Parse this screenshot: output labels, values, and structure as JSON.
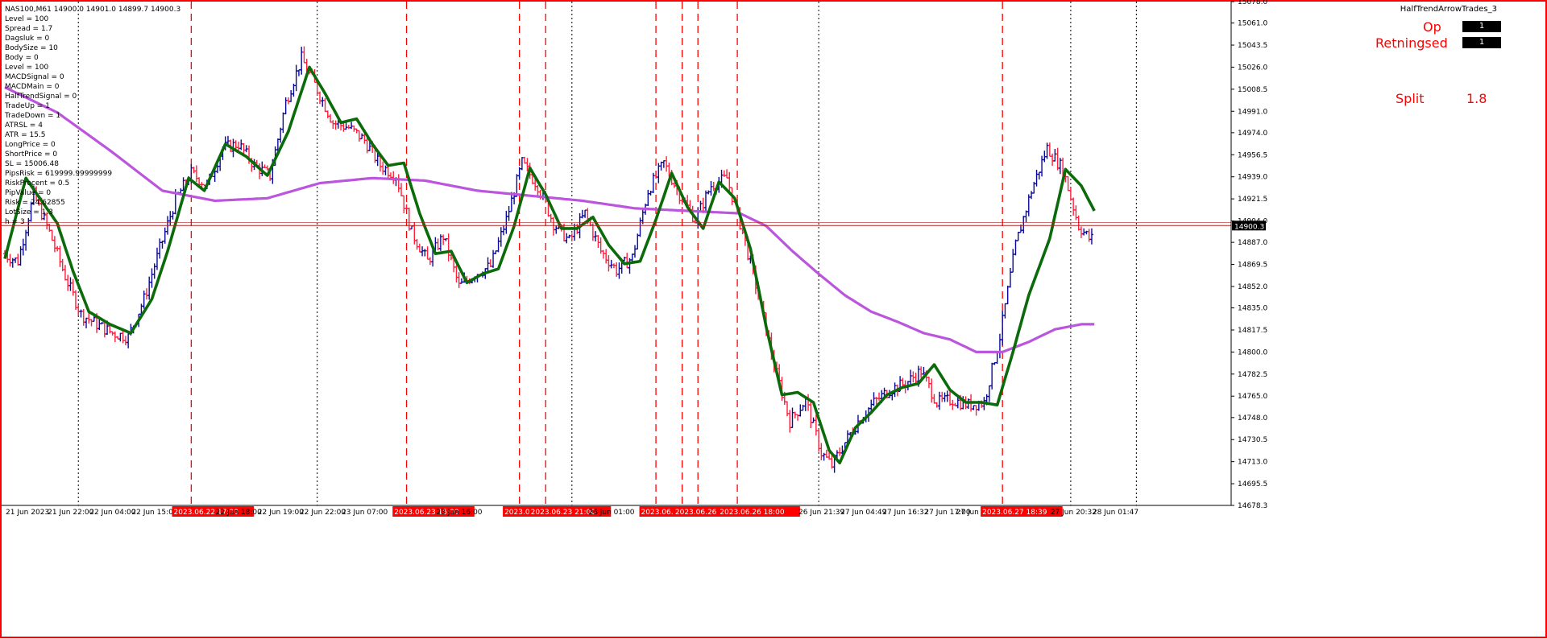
{
  "header": {
    "symbol_line": "NAS100,M61  14900.0 14901.0 14899.7 14900.3",
    "indicator_name": "HalfTrendArrowTrades_3",
    "info_lines": [
      "Level = 100",
      "Spread = 1.7",
      "Dagsluk = 0",
      "BodySize = 10",
      "Body = 0",
      "Level = 100",
      "MACDSignal = 0",
      "MACDMain = 0",
      "HalfTrendSignal = 0",
      "TradeUp = 1",
      "TradeDown = 1",
      "ATRSL = 4",
      "ATR = 15.5",
      "LongPrice = 0",
      "ShortPrice = 0",
      "SL = 15006.48",
      "PipsRisk = 619999.99999999",
      "RiskProcent = 0.5",
      "PipValue = 0",
      "Risk = 24.62855",
      "LotSize = 1.3",
      "h = 3"
    ]
  },
  "panel": {
    "op_label": "Op",
    "op_value": "1",
    "ret_label": "Retningsed",
    "ret_value": "1",
    "split_label": "Split",
    "split_value": "1.8"
  },
  "colors": {
    "bull": "#0a0a9a",
    "bear": "#ff1f3d",
    "halftrend": "#0b6b0b",
    "ma": "#bb55dd",
    "vline_red": "#ff0000",
    "vline_black": "#000000",
    "price_line": "#b22222"
  },
  "chart_data": {
    "type": "line",
    "ylim": [
      14678.3,
      15078.0
    ],
    "current_price": "14900.3",
    "y_ticks": [
      "15078.0",
      "15061.0",
      "15043.5",
      "15026.0",
      "15008.5",
      "14991.0",
      "14974.0",
      "14956.5",
      "14939.0",
      "14921.5",
      "14904.0",
      "14887.0",
      "14869.5",
      "14852.0",
      "14835.0",
      "14817.5",
      "14800.0",
      "14782.5",
      "14765.0",
      "14748.0",
      "14730.5",
      "14713.0",
      "14695.5",
      "14678.3"
    ],
    "x_labels": [
      {
        "bar": 0,
        "text": "21 Jun 2023",
        "highlight": false
      },
      {
        "bar": 16,
        "text": "21 Jun 22:00",
        "highlight": false
      },
      {
        "bar": 32,
        "text": "22 Jun 04:00",
        "highlight": false
      },
      {
        "bar": 48,
        "text": "22 Jun 15:00",
        "highlight": false
      },
      {
        "bar": 64,
        "text": "2023.06.22 17:00",
        "highlight": true
      },
      {
        "bar": 80,
        "text": "22 Jun 18:00",
        "highlight": false
      },
      {
        "bar": 96,
        "text": "22 Jun 19:00",
        "highlight": false
      },
      {
        "bar": 112,
        "text": "22 Jun 22:00",
        "highlight": false
      },
      {
        "bar": 128,
        "text": "23 Jun 07:00",
        "highlight": false
      },
      {
        "bar": 148,
        "text": "2023.06.23 15:00",
        "highlight": true
      },
      {
        "bar": 164,
        "text": "23 Jun 16:00",
        "highlight": false
      },
      {
        "bar": 190,
        "text": "2023.06.",
        "highlight": true
      },
      {
        "bar": 200,
        "text": "2023.06.23 21:00",
        "highlight": true
      },
      {
        "bar": 222,
        "text": "26 Jun 01:00",
        "highlight": false
      },
      {
        "bar": 242,
        "text": "2023.06.",
        "highlight": true
      },
      {
        "bar": 255,
        "text": "2023.06.26 1",
        "highlight": true
      },
      {
        "bar": 272,
        "text": "2023.06.26 18:00",
        "highlight": true
      },
      {
        "bar": 302,
        "text": "26 Jun 21:39",
        "highlight": false
      },
      {
        "bar": 318,
        "text": "27 Jun 04:49",
        "highlight": false
      },
      {
        "bar": 334,
        "text": "27 Jun 16:32",
        "highlight": false
      },
      {
        "bar": 350,
        "text": "27 Jun 17:00",
        "highlight": false
      },
      {
        "bar": 362,
        "text": "27 Jun 1",
        "highlight": false
      },
      {
        "bar": 372,
        "text": "2023.06.27 18:39",
        "highlight": true
      },
      {
        "bar": 398,
        "text": "27 Jun 20:32",
        "highlight": false
      },
      {
        "bar": 414,
        "text": "28 Jun 01:47",
        "highlight": false
      }
    ],
    "red_vlines_bars": [
      71,
      153,
      196,
      206,
      248,
      258,
      264,
      279,
      380
    ],
    "black_vlines_bars": [
      28,
      119,
      216,
      310,
      406,
      431
    ],
    "anchors": [
      [
        0,
        14878
      ],
      [
        6,
        14872
      ],
      [
        12,
        14925
      ],
      [
        18,
        14895
      ],
      [
        24,
        14860
      ],
      [
        30,
        14830
      ],
      [
        36,
        14822
      ],
      [
        42,
        14815
      ],
      [
        48,
        14812
      ],
      [
        54,
        14842
      ],
      [
        60,
        14882
      ],
      [
        66,
        14921
      ],
      [
        72,
        14942
      ],
      [
        78,
        14932
      ],
      [
        84,
        14962
      ],
      [
        90,
        14965
      ],
      [
        96,
        14948
      ],
      [
        102,
        14940
      ],
      [
        108,
        14998
      ],
      [
        114,
        15033
      ],
      [
        120,
        15008
      ],
      [
        126,
        14982
      ],
      [
        132,
        14978
      ],
      [
        138,
        14968
      ],
      [
        144,
        14948
      ],
      [
        150,
        14940
      ],
      [
        156,
        14895
      ],
      [
        162,
        14872
      ],
      [
        168,
        14892
      ],
      [
        174,
        14852
      ],
      [
        180,
        14862
      ],
      [
        186,
        14868
      ],
      [
        192,
        14905
      ],
      [
        198,
        14950
      ],
      [
        204,
        14932
      ],
      [
        210,
        14902
      ],
      [
        216,
        14888
      ],
      [
        222,
        14910
      ],
      [
        228,
        14880
      ],
      [
        234,
        14865
      ],
      [
        240,
        14875
      ],
      [
        246,
        14928
      ],
      [
        252,
        14950
      ],
      [
        258,
        14925
      ],
      [
        264,
        14905
      ],
      [
        270,
        14932
      ],
      [
        276,
        14938
      ],
      [
        282,
        14895
      ],
      [
        288,
        14845
      ],
      [
        294,
        14790
      ],
      [
        300,
        14745
      ],
      [
        306,
        14762
      ],
      [
        312,
        14720
      ],
      [
        316,
        14710
      ],
      [
        320,
        14725
      ],
      [
        326,
        14745
      ],
      [
        332,
        14760
      ],
      [
        338,
        14770
      ],
      [
        344,
        14775
      ],
      [
        350,
        14785
      ],
      [
        356,
        14760
      ],
      [
        362,
        14762
      ],
      [
        368,
        14758
      ],
      [
        374,
        14760
      ],
      [
        380,
        14812
      ],
      [
        386,
        14885
      ],
      [
        392,
        14928
      ],
      [
        398,
        14962
      ],
      [
        404,
        14945
      ],
      [
        410,
        14900
      ],
      [
        414,
        14890
      ]
    ],
    "halftrend_anchors": [
      [
        0,
        14874
      ],
      [
        8,
        14938
      ],
      [
        14,
        14920
      ],
      [
        20,
        14902
      ],
      [
        26,
        14864
      ],
      [
        32,
        14832
      ],
      [
        40,
        14822
      ],
      [
        48,
        14815
      ],
      [
        56,
        14842
      ],
      [
        62,
        14880
      ],
      [
        70,
        14938
      ],
      [
        76,
        14928
      ],
      [
        84,
        14965
      ],
      [
        92,
        14955
      ],
      [
        100,
        14940
      ],
      [
        108,
        14975
      ],
      [
        116,
        15026
      ],
      [
        122,
        15005
      ],
      [
        128,
        14982
      ],
      [
        134,
        14985
      ],
      [
        140,
        14965
      ],
      [
        146,
        14948
      ],
      [
        152,
        14950
      ],
      [
        158,
        14910
      ],
      [
        164,
        14878
      ],
      [
        170,
        14880
      ],
      [
        176,
        14855
      ],
      [
        182,
        14862
      ],
      [
        188,
        14866
      ],
      [
        194,
        14900
      ],
      [
        200,
        14946
      ],
      [
        206,
        14925
      ],
      [
        212,
        14898
      ],
      [
        218,
        14898
      ],
      [
        224,
        14907
      ],
      [
        230,
        14885
      ],
      [
        236,
        14870
      ],
      [
        242,
        14872
      ],
      [
        248,
        14905
      ],
      [
        254,
        14942
      ],
      [
        260,
        14915
      ],
      [
        266,
        14898
      ],
      [
        272,
        14935
      ],
      [
        278,
        14922
      ],
      [
        284,
        14882
      ],
      [
        290,
        14820
      ],
      [
        296,
        14766
      ],
      [
        302,
        14768
      ],
      [
        308,
        14760
      ],
      [
        314,
        14722
      ],
      [
        318,
        14712
      ],
      [
        324,
        14740
      ],
      [
        330,
        14752
      ],
      [
        336,
        14766
      ],
      [
        342,
        14772
      ],
      [
        348,
        14775
      ],
      [
        354,
        14790
      ],
      [
        360,
        14770
      ],
      [
        366,
        14760
      ],
      [
        372,
        14760
      ],
      [
        378,
        14758
      ],
      [
        384,
        14800
      ],
      [
        390,
        14845
      ],
      [
        398,
        14890
      ],
      [
        404,
        14945
      ],
      [
        410,
        14932
      ],
      [
        416,
        14908
      ]
    ],
    "ma_anchors": [
      [
        0,
        15010
      ],
      [
        20,
        14990
      ],
      [
        40,
        14960
      ],
      [
        60,
        14928
      ],
      [
        80,
        14920
      ],
      [
        100,
        14922
      ],
      [
        120,
        14934
      ],
      [
        140,
        14938
      ],
      [
        160,
        14936
      ],
      [
        180,
        14928
      ],
      [
        200,
        14924
      ],
      [
        220,
        14920
      ],
      [
        240,
        14914
      ],
      [
        260,
        14912
      ],
      [
        280,
        14910
      ],
      [
        290,
        14900
      ],
      [
        300,
        14880
      ],
      [
        310,
        14862
      ],
      [
        320,
        14845
      ],
      [
        330,
        14832
      ],
      [
        340,
        14824
      ],
      [
        350,
        14815
      ],
      [
        360,
        14810
      ],
      [
        370,
        14800
      ],
      [
        380,
        14800
      ],
      [
        390,
        14808
      ],
      [
        400,
        14818
      ],
      [
        410,
        14822
      ]
    ]
  }
}
